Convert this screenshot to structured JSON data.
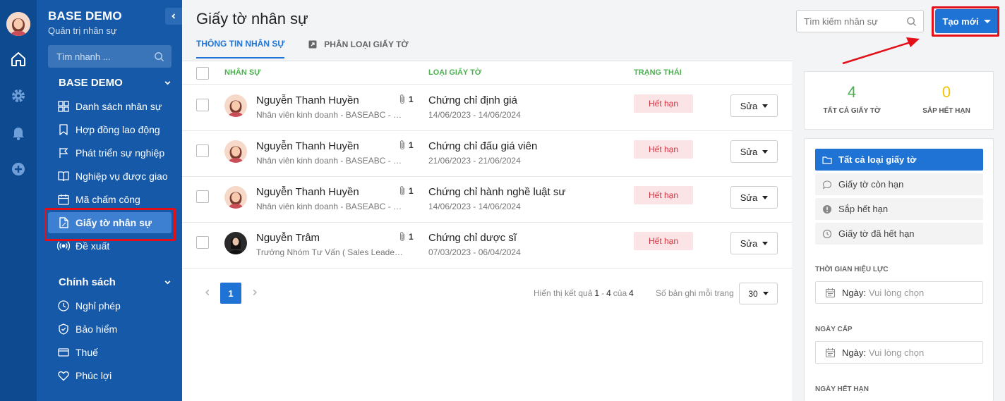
{
  "colors": {
    "rail": "#0d4a8f",
    "sidebar": "#1559a8",
    "primary": "#1e73d4",
    "success_header": "#4caf50",
    "expired_bg": "#fbe4e6",
    "expired_text": "#d23340",
    "highlight": "#e3101a",
    "stat_green": "#4caf50",
    "stat_yellow": "#f2c200"
  },
  "rail": {
    "icons": [
      "home-icon",
      "settings-icon",
      "bell-icon",
      "plus-circle-icon"
    ]
  },
  "sidebar": {
    "brand_title": "BASE DEMO",
    "brand_subtitle": "Quản trị nhân sự",
    "quick_search_placeholder": "Tìm nhanh ...",
    "section1_title": "BASE DEMO",
    "items1": [
      {
        "label": "Danh sách nhân sự",
        "icon": "grid-icon"
      },
      {
        "label": "Hợp đồng lao động",
        "icon": "bookmark-icon"
      },
      {
        "label": "Phát triển sự nghiệp",
        "icon": "flag-icon"
      },
      {
        "label": "Nghiệp vụ được giao",
        "icon": "book-icon"
      },
      {
        "label": "Mã chấm công",
        "icon": "calendar-icon"
      },
      {
        "label": "Giấy tờ nhân sự",
        "icon": "document-icon",
        "active": true
      },
      {
        "label": "Đề xuất",
        "icon": "broadcast-icon"
      }
    ],
    "section2_title": "Chính sách",
    "items2": [
      {
        "label": "Nghỉ phép",
        "icon": "clock-icon"
      },
      {
        "label": "Bảo hiểm",
        "icon": "shield-icon"
      },
      {
        "label": "Thuế",
        "icon": "card-icon"
      },
      {
        "label": "Phúc lợi",
        "icon": "heart-icon"
      }
    ]
  },
  "header": {
    "title": "Giấy tờ nhân sự",
    "tabs": [
      {
        "label": "THÔNG TIN NHÂN SỰ"
      },
      {
        "label": "PHÂN LOẠI GIẤY TỜ"
      }
    ],
    "search_placeholder": "Tìm kiếm nhân sự",
    "create_label": "Tạo mới"
  },
  "table": {
    "columns": {
      "employee": "NHÂN SỰ",
      "doc_type": "LOẠI GIẤY TỜ",
      "status": "TRẠNG THÁI"
    },
    "rows": [
      {
        "name": "Nguyễn Thanh Huyền",
        "position": "Nhân viên kinh doanh - BASEABC - Sales",
        "attachments": "1",
        "doc_type": "Chứng chỉ định giá",
        "dates": "14/06/2023 - 14/06/2024",
        "status": "Hết hạn",
        "edit": "Sửa",
        "avatar": "female-cartoon"
      },
      {
        "name": "Nguyễn Thanh Huyền",
        "position": "Nhân viên kinh doanh - BASEABC - Sales",
        "attachments": "1",
        "doc_type": "Chứng chỉ đấu giá viên",
        "dates": "21/06/2023 - 21/06/2024",
        "status": "Hết hạn",
        "edit": "Sửa",
        "avatar": "female-cartoon"
      },
      {
        "name": "Nguyễn Thanh Huyền",
        "position": "Nhân viên kinh doanh - BASEABC - Sales",
        "attachments": "1",
        "doc_type": "Chứng chỉ hành nghề luật sư",
        "dates": "14/06/2023 - 14/06/2024",
        "status": "Hết hạn",
        "edit": "Sửa",
        "avatar": "female-cartoon"
      },
      {
        "name": "Nguyễn Trâm",
        "position": "Trưởng Nhóm Tư Vấn ( Sales Leader) - BASEABC",
        "attachments": "1",
        "doc_type": "Chứng chỉ dược sĩ",
        "dates": "07/03/2023 - 06/04/2024",
        "status": "Hết hạn",
        "edit": "Sửa",
        "avatar": "photo"
      }
    ]
  },
  "pagination": {
    "current_page": "1",
    "info_prefix": "Hiển thị kết quả",
    "range_start": "1",
    "range_sep": "-",
    "range_end": "4",
    "of_label": "của",
    "total": "4",
    "page_size_label": "Số bản ghi mỗi trang",
    "page_size": "30"
  },
  "stats": [
    {
      "value": "4",
      "label": "TẤT CẢ GIẤY TỜ"
    },
    {
      "value": "0",
      "label": "SẮP HẾT HẠN"
    }
  ],
  "filters": {
    "items": [
      {
        "label": "Tất cả loại giấy tờ",
        "icon": "folder-icon",
        "active": true
      },
      {
        "label": "Giấy tờ còn hạn",
        "icon": "chat-bubble-icon"
      },
      {
        "label": "Sắp hết hạn",
        "icon": "alert-icon"
      },
      {
        "label": "Giấy tờ đã hết hạn",
        "icon": "clock-icon"
      }
    ],
    "groups": [
      {
        "label": "THỜI GIAN HIỆU LỰC",
        "field_label": "Ngày:",
        "placeholder": "Vui lòng chọn"
      },
      {
        "label": "NGÀY CẤP",
        "field_label": "Ngày:",
        "placeholder": "Vui lòng chọn"
      },
      {
        "label": "NGÀY HẾT HẠN"
      }
    ]
  }
}
